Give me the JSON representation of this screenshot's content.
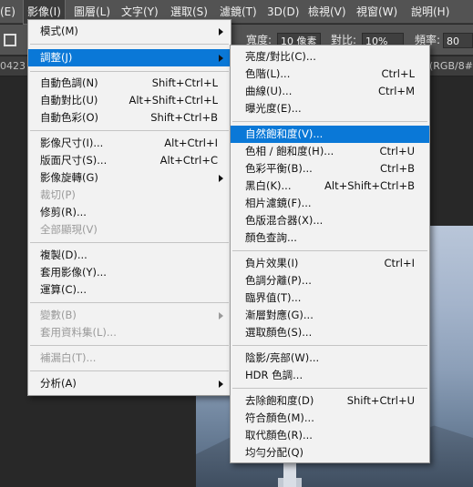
{
  "menubar": {
    "items": [
      {
        "label": "(E)"
      },
      {
        "label": "影像(I)"
      },
      {
        "label": "圖層(L)"
      },
      {
        "label": "文字(Y)"
      },
      {
        "label": "選取(S)"
      },
      {
        "label": "濾鏡(T)"
      },
      {
        "label": "3D(D)"
      },
      {
        "label": "檢視(V)"
      },
      {
        "label": "視窗(W)"
      },
      {
        "label": "說明(H)"
      }
    ]
  },
  "options_bar": {
    "width_label": "寬度:",
    "width_value": "10 像素",
    "contrast_label": "對比:",
    "contrast_value": "10%",
    "frequency_label": "頻率:",
    "frequency_value": "80"
  },
  "document_tabs": {
    "left_fragment": "0423",
    "right_fragment": "(RGB/8#"
  },
  "image_menu": {
    "items": [
      {
        "label": "模式(M)",
        "submenu": true
      },
      {
        "label": "調整(J)",
        "submenu": true,
        "highlighted": true
      },
      {
        "label": "自動色調(N)",
        "shortcut": "Shift+Ctrl+L"
      },
      {
        "label": "自動對比(U)",
        "shortcut": "Alt+Shift+Ctrl+L"
      },
      {
        "label": "自動色彩(O)",
        "shortcut": "Shift+Ctrl+B"
      },
      {
        "label": "影像尺寸(I)...",
        "shortcut": "Alt+Ctrl+I"
      },
      {
        "label": "版面尺寸(S)...",
        "shortcut": "Alt+Ctrl+C"
      },
      {
        "label": "影像旋轉(G)",
        "submenu": true
      },
      {
        "label": "裁切(P)",
        "disabled": true
      },
      {
        "label": "修剪(R)..."
      },
      {
        "label": "全部顯現(V)",
        "disabled": true
      },
      {
        "label": "複製(D)..."
      },
      {
        "label": "套用影像(Y)..."
      },
      {
        "label": "運算(C)..."
      },
      {
        "label": "變數(B)",
        "submenu": true,
        "disabled": true
      },
      {
        "label": "套用資料集(L)...",
        "disabled": true
      },
      {
        "label": "補漏白(T)...",
        "disabled": true
      },
      {
        "label": "分析(A)",
        "submenu": true
      }
    ]
  },
  "adjustments_menu": {
    "items": [
      {
        "label": "亮度/對比(C)..."
      },
      {
        "label": "色階(L)...",
        "shortcut": "Ctrl+L"
      },
      {
        "label": "曲線(U)...",
        "shortcut": "Ctrl+M"
      },
      {
        "label": "曝光度(E)..."
      },
      {
        "label": "自然飽和度(V)...",
        "highlighted": true
      },
      {
        "label": "色相 / 飽和度(H)...",
        "shortcut": "Ctrl+U"
      },
      {
        "label": "色彩平衡(B)...",
        "shortcut": "Ctrl+B"
      },
      {
        "label": "黑白(K)...",
        "shortcut": "Alt+Shift+Ctrl+B"
      },
      {
        "label": "相片濾鏡(F)..."
      },
      {
        "label": "色版混合器(X)..."
      },
      {
        "label": "顏色查詢..."
      },
      {
        "label": "負片效果(I)",
        "shortcut": "Ctrl+I"
      },
      {
        "label": "色調分離(P)..."
      },
      {
        "label": "臨界值(T)..."
      },
      {
        "label": "漸層對應(G)..."
      },
      {
        "label": "選取顏色(S)..."
      },
      {
        "label": "陰影/亮部(W)..."
      },
      {
        "label": "HDR 色調..."
      },
      {
        "label": "去除飽和度(D)",
        "shortcut": "Shift+Ctrl+U"
      },
      {
        "label": "符合顏色(M)..."
      },
      {
        "label": "取代顏色(R)..."
      },
      {
        "label": "均勻分配(Q)"
      }
    ]
  },
  "colors": {
    "highlight": "#0a78d7",
    "menu_bg": "#f2f2f2",
    "chrome": "#535353"
  }
}
